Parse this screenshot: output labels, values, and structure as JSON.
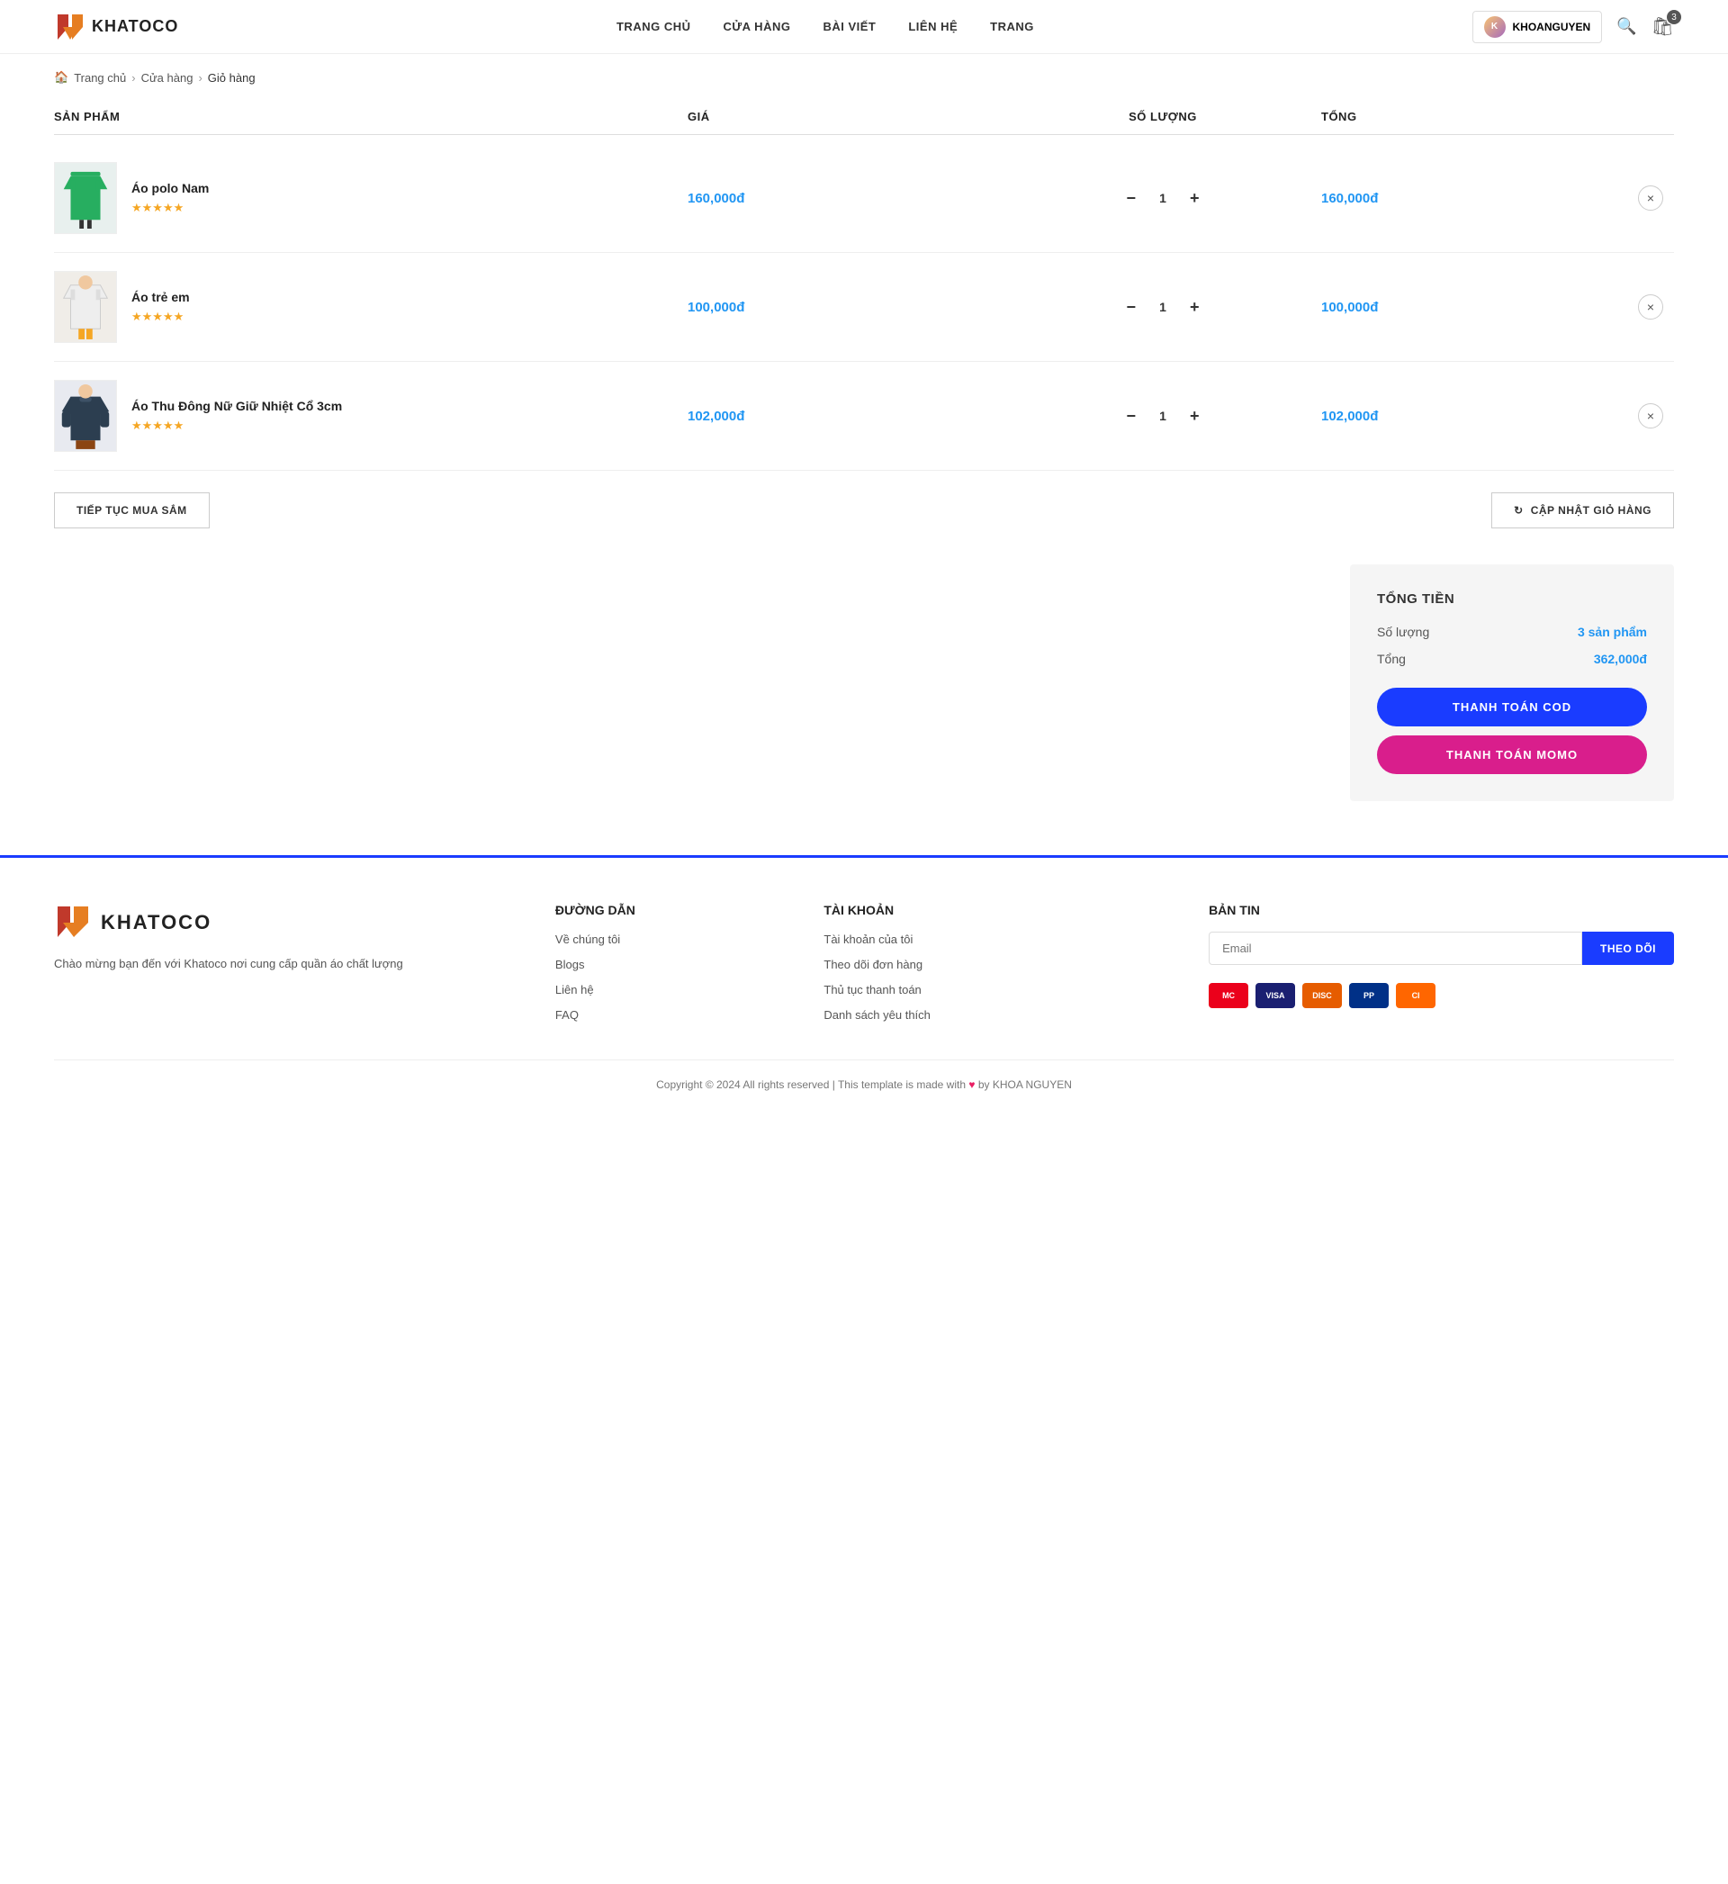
{
  "header": {
    "logo_text": "KHATOCO",
    "nav": [
      {
        "label": "TRANG CHỦ",
        "href": "#"
      },
      {
        "label": "CỬA HÀNG",
        "href": "#"
      },
      {
        "label": "BÀI VIẾT",
        "href": "#"
      },
      {
        "label": "LIÊN HỆ",
        "href": "#"
      },
      {
        "label": "TRANG",
        "href": "#"
      }
    ],
    "user_label": "KHOANGUYEN",
    "cart_count": "3"
  },
  "breadcrumb": {
    "home": "Trang chủ",
    "store": "Cửa hàng",
    "current": "Giỏ hàng"
  },
  "cart": {
    "columns": {
      "product": "SẢN PHẨM",
      "price": "GIÁ",
      "quantity": "SỐ LƯỢNG",
      "total": "TỔNG"
    },
    "items": [
      {
        "name": "Áo polo Nam",
        "stars": "★★★★★",
        "price": "160,000đ",
        "qty": "1",
        "total": "160,000đ",
        "thumb_type": "polo"
      },
      {
        "name": "Áo trẻ em",
        "stars": "★★★★★",
        "price": "100,000đ",
        "qty": "1",
        "total": "100,000đ",
        "thumb_type": "kids"
      },
      {
        "name": "Áo Thu Đông Nữ Giữ Nhiệt Cổ 3cm",
        "stars": "★★★★★",
        "price": "102,000đ",
        "qty": "1",
        "total": "102,000đ",
        "thumb_type": "winter"
      }
    ],
    "continue_btn": "TIẾP TỤC MUA SẮM",
    "update_btn": "CẬP NHẬT GIỎ HÀNG"
  },
  "summary": {
    "title": "TỔNG TIỀN",
    "quantity_label": "Số lượng",
    "quantity_value": "3 sản phẩm",
    "total_label": "Tổng",
    "total_value": "362,000đ",
    "pay_cod_btn": "THANH TOÁN COD",
    "pay_momo_btn": "THANH TOÁN MOMO"
  },
  "footer": {
    "logo_text": "KHATOCO",
    "description": "Chào mừng bạn đến với Khatoco nơi cung cấp quần áo chất lượng",
    "col_guide": {
      "title": "ĐƯỜNG DẪN",
      "links": [
        "Về chúng tôi",
        "Blogs",
        "Liên hệ",
        "FAQ"
      ]
    },
    "col_account": {
      "title": "TÀI KHOẢN",
      "links": [
        "Tài khoản của tôi",
        "Theo dõi đơn hàng",
        "Thủ tục thanh toán",
        "Danh sách yêu thích"
      ]
    },
    "col_newsletter": {
      "title": "BẢN TIN",
      "email_placeholder": "Email",
      "subscribe_btn": "THEO DÕI"
    },
    "payment_icons": [
      "MC",
      "VISA",
      "DISC",
      "PP",
      "CI"
    ],
    "copyright": "Copyright © 2024 All rights reserved | This template is made with",
    "copyright_suffix": "by KHOA NGUYEN"
  }
}
